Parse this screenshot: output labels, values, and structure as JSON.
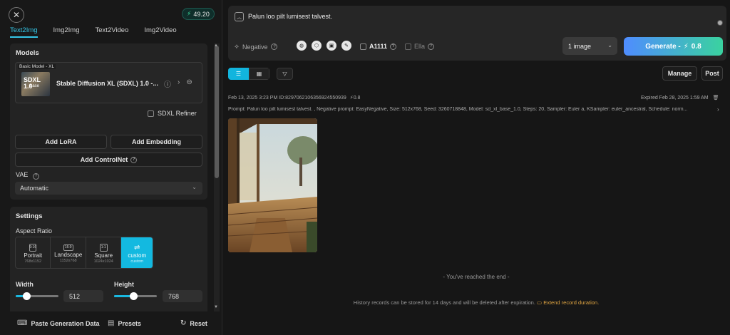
{
  "header": {
    "close_label": "✕",
    "credits": "49.20"
  },
  "tabs": [
    {
      "label": "Text2Img",
      "active": true
    },
    {
      "label": "Img2Img"
    },
    {
      "label": "Text2Video"
    },
    {
      "label": "Img2Video"
    }
  ],
  "models": {
    "title": "Models",
    "card": {
      "tag": "Basic Model - XL",
      "thumb_title": "SDXL 1.0",
      "thumb_sub": "base",
      "name": "Stable Diffusion XL (SDXL) 1.0 -..."
    },
    "refiner_label": "SDXL Refiner",
    "add_lora": "Add LoRA",
    "add_embedding": "Add Embedding",
    "add_controlnet": "Add ControlNet",
    "vae_label": "VAE",
    "vae_value": "Automatic"
  },
  "settings": {
    "title": "Settings",
    "aspect_label": "Aspect Ratio",
    "aspects": [
      {
        "name": "Portrait",
        "dims": "768x1152",
        "icon": "9:16"
      },
      {
        "name": "Landscape",
        "dims": "1152x768",
        "icon": "16:9"
      },
      {
        "name": "Square",
        "dims": "1024x1024",
        "icon": "1:1"
      },
      {
        "name": "custom",
        "dims": "custom",
        "icon": "⇌",
        "active": true
      }
    ],
    "width_label": "Width",
    "width_value": "512",
    "width_level": 0.25,
    "height_label": "Height",
    "height_value": "768",
    "height_level": 0.45
  },
  "bottom": {
    "paste": "Paste Generation Data",
    "presets": "Presets",
    "reset": "Reset"
  },
  "prompt": {
    "text": "Palun loo pilt lumisest talvest.",
    "negative_label": "Negative",
    "a1111_label": "A1111",
    "ella_label": "Ella",
    "count_value": "1 image",
    "generate_label": "Generate - ",
    "generate_cost": "0.8"
  },
  "toolbar": {
    "manage": "Manage",
    "post": "Post"
  },
  "record": {
    "meta": "Feb 13, 2025 3:23 PM ID:829706210635692455093​9",
    "cost": "0.8",
    "expired": "Expired Feb 28, 2025 1:59 AM",
    "params": "Prompt: Palun loo pilt lumisest talvest. , Negative prompt: EasyNegative, Size: 512x768, Seed: 3260718848, Model: sd_xl_base_1.0, Steps: 20, Sampler: Euler a, KSampler: euler_ancestral, Schedule: norm..."
  },
  "end_text": "- You've reached the end -",
  "footer": {
    "note": "History records can be stored for 14 days and will be deleted after expiration.",
    "link": "Extend record duration."
  },
  "colors": {
    "accent": "#13b9e0",
    "generate_start": "#4f8cff",
    "generate_end": "#3ad29f",
    "link": "#e0a542"
  }
}
